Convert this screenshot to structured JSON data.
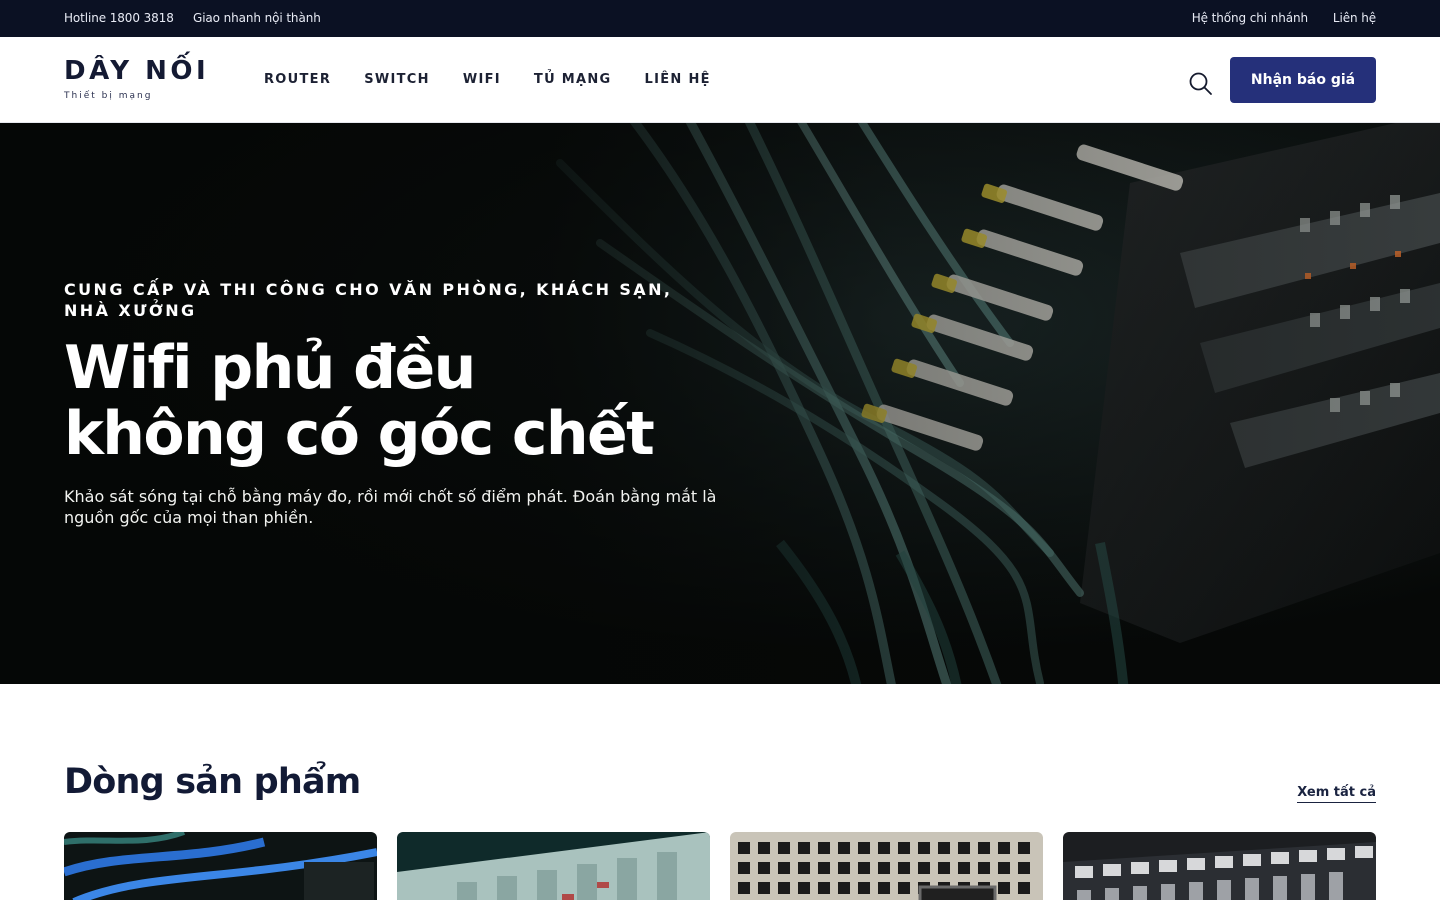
{
  "topbar": {
    "hotline": "Hotline 1800 3818",
    "delivery": "Giao nhanh nội thành",
    "branches": "Hệ thống chi nhánh",
    "contact": "Liên hệ"
  },
  "header": {
    "logo_main": "DÂY NỐI",
    "logo_tagline": "Thiết bị mạng",
    "nav": [
      "ROUTER",
      "SWITCH",
      "WIFI",
      "TỦ MẠNG",
      "LIÊN HỆ"
    ],
    "search_icon": "search-icon",
    "cta_label": "Nhận báo giá"
  },
  "hero": {
    "eyebrow": "CUNG CẤP VÀ THI CÔNG CHO VĂN PHÒNG, KHÁCH SẠN, NHÀ XƯỞNG",
    "title_line1": "Wifi phủ đều",
    "title_line2": "không có góc chết",
    "description": "Khảo sát sóng tại chỗ bằng máy đo, rồi mới chốt số điểm phát. Đoán bằng mắt là nguồn gốc của mọi than phiền."
  },
  "products": {
    "title": "Dòng sản phẩm",
    "view_all": "Xem tất cả"
  },
  "colors": {
    "topbar_bg": "#0b1123",
    "accent": "#25307a",
    "heading": "#121a35"
  }
}
